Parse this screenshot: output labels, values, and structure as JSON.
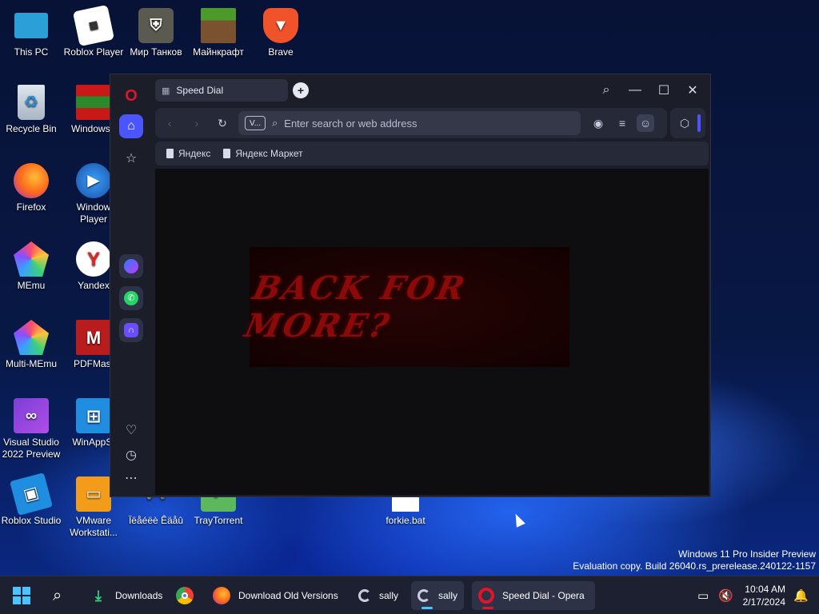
{
  "desktop": {
    "icons": [
      {
        "label": "This PC"
      },
      {
        "label": "Roblox Player"
      },
      {
        "label": "Мир Танков"
      },
      {
        "label": "Майнкрафт"
      },
      {
        "label": "Brave"
      },
      {
        "label": "Recycle Bin"
      },
      {
        "label": "WindowsF"
      },
      {
        "label": "Firefox"
      },
      {
        "label": "Window Player"
      },
      {
        "label": "MEmu"
      },
      {
        "label": "Yandex"
      },
      {
        "label": "Multi-MEmu"
      },
      {
        "label": "PDFMast"
      },
      {
        "label": "Visual Studio 2022 Preview"
      },
      {
        "label": "WinAppSt"
      },
      {
        "label": "Roblox Studio"
      },
      {
        "label": "VMware Workstati..."
      },
      {
        "label": "Ïëåéëè Êäåû"
      },
      {
        "label": "TrayTorrent"
      },
      {
        "label": "forkie.bat"
      }
    ],
    "watermark_line1": "Windows 11 Pro Insider Preview",
    "watermark_line2": "Evaluation copy. Build 26040.rs_prerelease.240122-1157"
  },
  "browser": {
    "tab_title": "Speed Dial",
    "address_placeholder": "Enter search or web address",
    "address_badge": "V...",
    "bookmarks": [
      {
        "label": "Яндекс"
      },
      {
        "label": "Яндекс Маркет"
      }
    ],
    "banner_text": "BACK FOR MORE?"
  },
  "taskbar": {
    "items": [
      {
        "label": "Downloads"
      },
      {
        "label": "Download Old Versions"
      },
      {
        "label": "sally"
      },
      {
        "label": "sally"
      },
      {
        "label": "Speed Dial - Opera"
      }
    ],
    "time": "10:04 AM",
    "date": "2/17/2024"
  },
  "colors": {
    "opera_red": "#e0142b",
    "accent_blue": "#4a55ff",
    "taskbar_bg": "#1d2030"
  }
}
